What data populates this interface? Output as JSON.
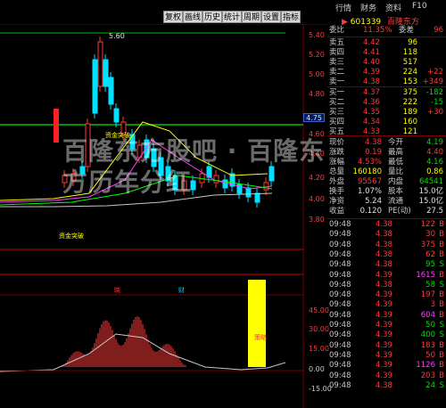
{
  "toolbar": {
    "buttons": [
      "复权",
      "画线",
      "历史",
      "统计",
      "周期",
      "设置",
      "指标"
    ],
    "right_links": [
      "行情",
      "财务",
      "资料",
      "F10"
    ]
  },
  "stock": {
    "code": "601339",
    "name": "百隆东方"
  },
  "order_book": {
    "ratio_label": "委比",
    "ratio_value": "11.35%",
    "diff_label": "委差",
    "diff_value": "96",
    "asks": [
      {
        "label": "卖五",
        "price": "4.42",
        "vol": "96",
        "chg": ""
      },
      {
        "label": "卖四",
        "price": "4.41",
        "vol": "118",
        "chg": ""
      },
      {
        "label": "卖三",
        "price": "4.40",
        "vol": "517",
        "chg": ""
      },
      {
        "label": "卖二",
        "price": "4.39",
        "vol": "224",
        "chg": "+22"
      },
      {
        "label": "卖一",
        "price": "4.38",
        "vol": "153",
        "chg": "+349"
      }
    ],
    "bids": [
      {
        "label": "买一",
        "price": "4.37",
        "vol": "375",
        "chg": "-182"
      },
      {
        "label": "买二",
        "price": "4.36",
        "vol": "222",
        "chg": "-15"
      },
      {
        "label": "买三",
        "price": "4.35",
        "vol": "189",
        "chg": "+30"
      },
      {
        "label": "买四",
        "price": "4.34",
        "vol": "160",
        "chg": ""
      },
      {
        "label": "买五",
        "price": "4.33",
        "vol": "121",
        "chg": ""
      }
    ]
  },
  "quote": [
    {
      "l1": "现价",
      "v1": "4.38",
      "c1": "red",
      "l2": "今开",
      "v2": "4.19",
      "c2": "green"
    },
    {
      "l1": "涨跌",
      "v1": "0.19",
      "c1": "red",
      "l2": "最高",
      "v2": "4.40",
      "c2": "red"
    },
    {
      "l1": "涨幅",
      "v1": "4.53%",
      "c1": "red",
      "l2": "最低",
      "v2": "4.16",
      "c2": "green"
    },
    {
      "l1": "总量",
      "v1": "160180",
      "c1": "yellow",
      "l2": "量比",
      "v2": "0.86",
      "c2": "yellow"
    },
    {
      "l1": "外盘",
      "v1": "95567",
      "c1": "red",
      "l2": "内盘",
      "v2": "64541",
      "c2": "green"
    },
    {
      "l1": "换手",
      "v1": "1.07%",
      "c1": "white",
      "l2": "股本",
      "v2": "15.0亿",
      "c2": "white"
    },
    {
      "l1": "净资",
      "v1": "5.24",
      "c1": "white",
      "l2": "流通",
      "v2": "15.0亿",
      "c2": "white"
    },
    {
      "l1": "收益",
      "v1": "0.120",
      "c1": "white",
      "l2": "PE(动)",
      "v2": "27.5",
      "c2": "white"
    }
  ],
  "ticks": [
    {
      "time": "09:48",
      "price": "4.38",
      "vol": "122",
      "side": "B",
      "vc": "red"
    },
    {
      "time": "09:48",
      "price": "4.38",
      "vol": "30",
      "side": "B",
      "vc": "red"
    },
    {
      "time": "09:48",
      "price": "4.38",
      "vol": "375",
      "side": "B",
      "vc": "red"
    },
    {
      "time": "09:48",
      "price": "4.38",
      "vol": "62",
      "side": "B",
      "vc": "red"
    },
    {
      "time": "09:48",
      "price": "4.38",
      "vol": "95",
      "side": "S",
      "vc": "green"
    },
    {
      "time": "09:48",
      "price": "4.39",
      "vol": "1615",
      "side": "B",
      "vc": "magenta"
    },
    {
      "time": "09:48",
      "price": "4.38",
      "vol": "58",
      "side": "S",
      "vc": "green"
    },
    {
      "time": "09:48",
      "price": "4.39",
      "vol": "197",
      "side": "B",
      "vc": "red"
    },
    {
      "time": "09:48",
      "price": "4.39",
      "vol": "3",
      "side": "B",
      "vc": "red"
    },
    {
      "time": "09:48",
      "price": "4.39",
      "vol": "604",
      "side": "B",
      "vc": "magenta"
    },
    {
      "time": "09:48",
      "price": "4.39",
      "vol": "50",
      "side": "S",
      "vc": "green"
    },
    {
      "time": "09:48",
      "price": "4.39",
      "vol": "400",
      "side": "S",
      "vc": "green"
    },
    {
      "time": "09:48",
      "price": "4.39",
      "vol": "183",
      "side": "B",
      "vc": "red"
    },
    {
      "time": "09:48",
      "price": "4.39",
      "vol": "50",
      "side": "B",
      "vc": "red"
    },
    {
      "time": "09:48",
      "price": "4.39",
      "vol": "1126",
      "side": "B",
      "vc": "magenta"
    },
    {
      "time": "09:48",
      "price": "4.39",
      "vol": "203",
      "side": "B",
      "vc": "red"
    },
    {
      "time": "09:48",
      "price": "4.38",
      "vol": "24",
      "side": "S",
      "vc": "green"
    }
  ],
  "kchart": {
    "y_labels": [
      "5.60",
      "5.40",
      "5.20",
      "5.00",
      "4.80",
      "4.75",
      "4.60",
      "4.40",
      "4.20",
      "4.00",
      "3.80"
    ],
    "peak_label": "5.60",
    "signal_labels": [
      "资金突破",
      "资金突破"
    ],
    "markers": [
      "晓",
      "财"
    ]
  },
  "macd": {
    "y_labels": [
      "45.00",
      "30.00",
      "15.00",
      "0.00",
      "-15.00"
    ],
    "bar_label": "策略"
  },
  "watermark": {
    "line1": "百隆东方股吧 · 百隆东",
    "line2": "方历年分红"
  },
  "colors": {
    "up": "#ff3b3b",
    "down": "#00e0ff",
    "ma": "#ffff00",
    "panel_sep": "#7a0000"
  }
}
